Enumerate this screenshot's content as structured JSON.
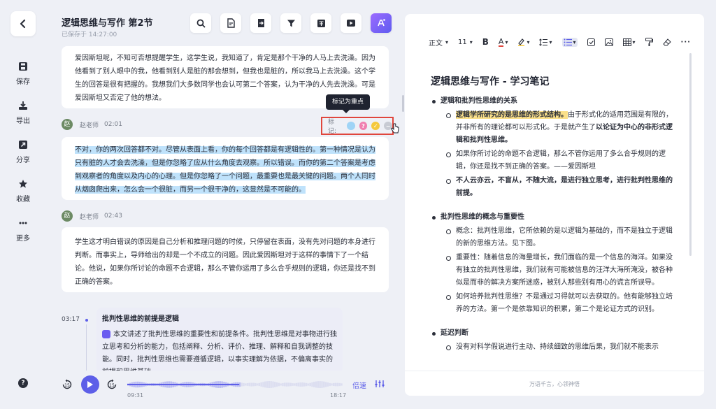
{
  "rail": {
    "items": [
      {
        "label": "保存",
        "icon": "save-icon"
      },
      {
        "label": "导出",
        "icon": "export-icon"
      },
      {
        "label": "分享",
        "icon": "share-icon"
      },
      {
        "label": "收藏",
        "icon": "star-icon"
      },
      {
        "label": "更多",
        "icon": "more-icon"
      }
    ],
    "help": "?"
  },
  "header": {
    "title": "逻辑思维与写作 第2节",
    "saved": "已保存于 14:27:00"
  },
  "transcript": {
    "first_paragraph": "爱因斯坦呢，不知可否想提醒学生，这学生说，我知道了，肯定是那个干净的人马上去洗澡。因为他看到了别人眼中的我，他看到别人是脏的那会想到，但我也是脏的，所以我马上去洗澡。这个学生的回答是很有把握的。我想我们大多数同学也会认可第二个答案，认为干净的人先去洗澡。可是爱因斯坦又否定了他的想法。",
    "entries": [
      {
        "avatar": "赵",
        "speaker": "赵老师",
        "time": "02:01",
        "text": "不对，你的两次回答都不对。尽管从表面上看，你的每个回答都是有逻辑性的。第一种情况是认为只有脏的人才会去洗澡，但是你忽略了应从什么角度去观察。所以错误。而你的第二个答案是考虑到观察者的角度以及内心的心理。但是你忽略了一个问题，最重要也是最关键的问题。两个人同时从烟囱爬出来，怎么会一个很脏，而另一个很干净的，这显然是不可能的。"
      },
      {
        "avatar": "赵",
        "speaker": "赵老师",
        "time": "02:43",
        "text": "学生这才明白错误的原因是自己分析和推理问题的时候，只停留在表面，没有先对问题的本身进行判断。而事实上，导师给出的却是一个不成立的问题。因此爱因斯坦对于这样的事情下了一个结论。他说，如果你所讨论的命题不合逻辑，那么不管你运用了多么合乎规则的逻辑，你还是找不到正确的答案。"
      }
    ],
    "mark_label": "标记:",
    "tooltip": "标记为重点"
  },
  "chapter": {
    "time": "03:17",
    "title": "批判性思维的前提是逻辑",
    "summary": "本文讲述了批判性思维的重要性和前提条件。批判性思维是对事物进行独立思考和分析的能力，包括阐释、分析、评价、推理、解释和自我调整的技能。同时，批判性思维也需要遵循逻辑，以事实理解为依据，不偏离事实的前提和思维基础。"
  },
  "player": {
    "current": "09:31",
    "total": "18:17",
    "speed_label": "倍速",
    "progress": 0.52
  },
  "editor": {
    "toolbar": {
      "style": "正文",
      "font_size": "11"
    },
    "doc_title": "逻辑思维与写作 - 学习笔记",
    "sections": [
      {
        "heading": "逻辑和批判性思维的关系",
        "items": [
          {
            "highlight": "逻辑学所研究的是思维的形式结构。",
            "text": "由于形式化的适用范围是有限的，并非所有的理论都可以形式化。于是就产生了",
            "bold_tail": "以论证为中心的非形式逻辑和批判性思维。"
          },
          {
            "text": "如果你所讨论的命题不合逻辑，那么不管你运用了多么合乎规则的逻辑，你还是找不到正确的答案。——爱因斯坦"
          },
          {
            "bold": "不人云亦云，不盲从，不随大流，是进行独立思考，进行批判性思维的前提。"
          }
        ]
      },
      {
        "heading": "批判性思维的概念与重要性",
        "items": [
          {
            "text": "概念：批判性思维，它所依赖的是以逻辑为基础的，而不是独立于逻辑的新的思维方法。见下图。"
          },
          {
            "text": "重要性：随着信息的海量增长，我们面临的是一个信息的海洋。如果没有独立的批判性思维，我们就有可能被信息的汪洋大海所淹没，被各种似是而非的解决方案所迷惑，被别人那些别有用心的谎言所误导。"
          },
          {
            "text": "如何培养批判性思维？不是通过习得就可以去获取的。他有能够独立培养的方法。第一个是依靠知识的积累，第二个是论证方式的识别。"
          }
        ]
      },
      {
        "heading": "延迟判断",
        "items": [
          {
            "text": "没有对科学假说进行主动、持续细致的思维后果，我们就不能表示"
          }
        ]
      }
    ],
    "footer": "万语千言，心领神悟"
  }
}
